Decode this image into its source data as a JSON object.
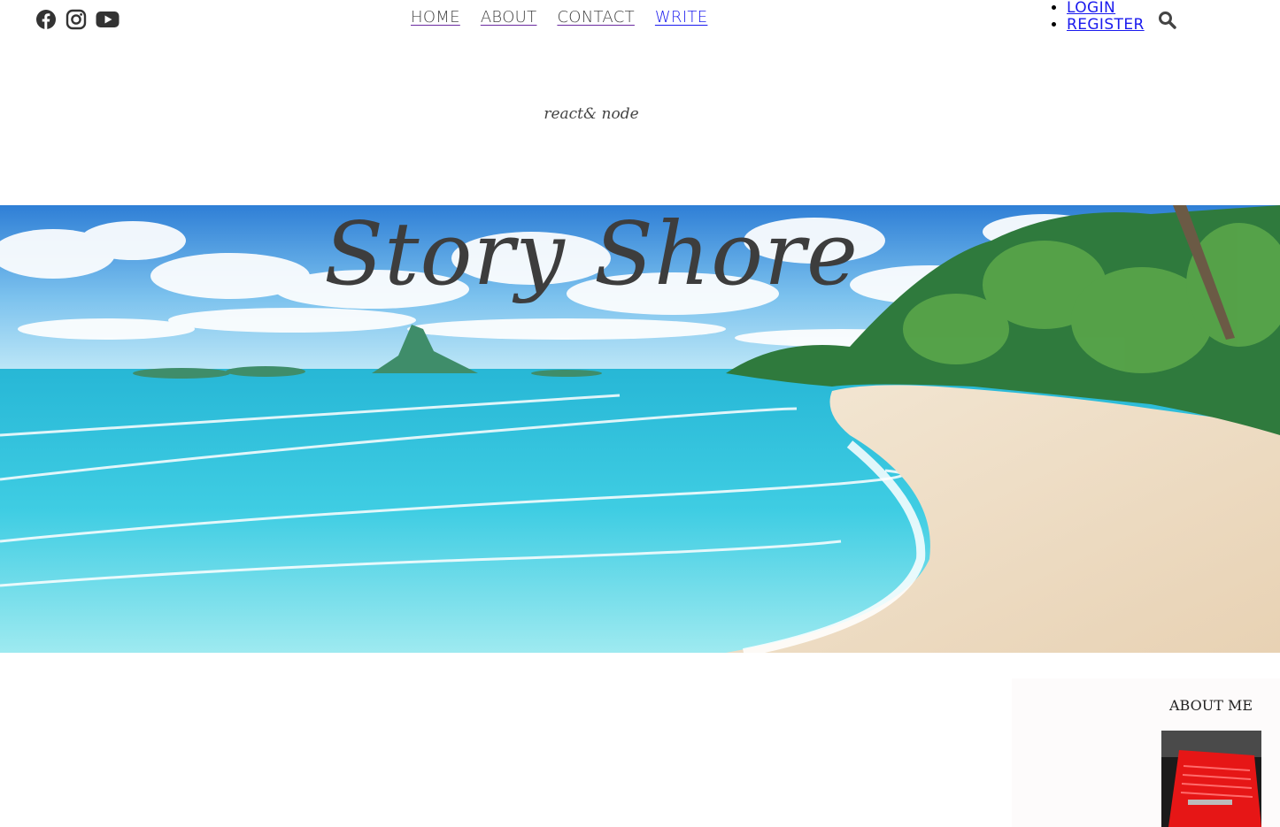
{
  "social": [
    {
      "name": "facebook-icon"
    },
    {
      "name": "instagram-icon"
    },
    {
      "name": "youtube-icon"
    }
  ],
  "nav": {
    "items": [
      {
        "label": "HOME"
      },
      {
        "label": "ABOUT"
      },
      {
        "label": "CONTACT"
      },
      {
        "label": "WRITE"
      }
    ]
  },
  "auth": {
    "login": "LOGIN",
    "register": "REGISTER"
  },
  "header": {
    "tagline": "react& node",
    "title": "Story Shore"
  },
  "sidebar": {
    "title": "ABOUT ME"
  }
}
